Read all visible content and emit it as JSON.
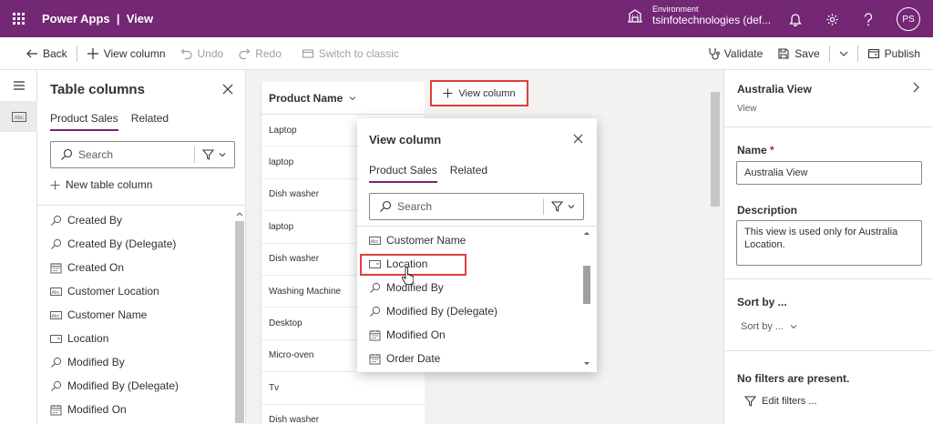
{
  "header": {
    "app_title": "Power Apps  |  View",
    "env_label": "Environment",
    "env_name": "tsinfotechnologies (def...",
    "avatar_initials": "PS"
  },
  "commands": {
    "back": "Back",
    "view_column": "View column",
    "undo": "Undo",
    "redo": "Redo",
    "switch_classic": "Switch to classic",
    "validate": "Validate",
    "save": "Save",
    "publish": "Publish"
  },
  "table_columns": {
    "title": "Table columns",
    "tabs": [
      "Product Sales",
      "Related"
    ],
    "search_placeholder": "Search",
    "new_column": "New table column",
    "items": [
      {
        "icon": "lookup-icon",
        "label": "Created By"
      },
      {
        "icon": "lookup-icon",
        "label": "Created By (Delegate)"
      },
      {
        "icon": "calendar-icon",
        "label": "Created On"
      },
      {
        "icon": "text-field-icon",
        "label": "Customer Location"
      },
      {
        "icon": "text-field-icon",
        "label": "Customer Name"
      },
      {
        "icon": "choice-icon",
        "label": "Location"
      },
      {
        "icon": "lookup-icon",
        "label": "Modified By"
      },
      {
        "icon": "lookup-icon",
        "label": "Modified By (Delegate)"
      },
      {
        "icon": "calendar-icon",
        "label": "Modified On"
      }
    ]
  },
  "grid": {
    "header": "Product Name",
    "rows": [
      "Laptop",
      "laptop",
      "Dish washer",
      "laptop",
      "Dish washer",
      "Washing Machine",
      "Desktop",
      "Micro-oven",
      "Tv",
      "Dish washer"
    ]
  },
  "add_column_button": "View column",
  "popup": {
    "title": "View column",
    "tabs": [
      "Product Sales",
      "Related"
    ],
    "search_placeholder": "Search",
    "items": [
      {
        "icon": "text-field-icon",
        "label": "Customer Name"
      },
      {
        "icon": "choice-icon",
        "label": "Location"
      },
      {
        "icon": "lookup-icon",
        "label": "Modified By"
      },
      {
        "icon": "lookup-icon",
        "label": "Modified By (Delegate)"
      },
      {
        "icon": "calendar-icon",
        "label": "Modified On"
      },
      {
        "icon": "calendar-icon",
        "label": "Order Date"
      }
    ]
  },
  "properties": {
    "title": "Australia View",
    "subtitle": "View",
    "name_label": "Name",
    "required_marker": "*",
    "name_value": "Australia View",
    "description_label": "Description",
    "description_value": "This view is used only for Australia Location.",
    "sort_label": "Sort by ...",
    "sort_dropdown": "Sort by ...",
    "no_filters": "No filters are present.",
    "edit_filters": "Edit filters ..."
  },
  "colors": {
    "brand": "#742774",
    "highlight": "#e0403a"
  }
}
